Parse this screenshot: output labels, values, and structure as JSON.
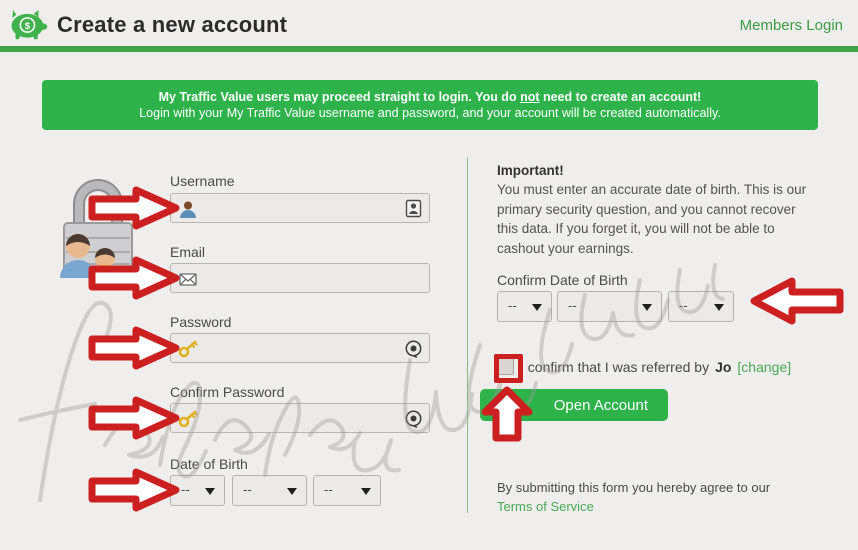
{
  "header": {
    "logo_icon": "piggy-bank-icon",
    "title": "Create a new account",
    "members_login": "Members Login",
    "accent_green": "#41a24a"
  },
  "banner": {
    "line1_a": "My Traffic Value users may proceed straight to login. You do ",
    "line1_underlined": "not",
    "line1_b": " need to create an account!",
    "line2": "Login with your My Traffic Value username and password, and your account will be created automatically.",
    "background": "#2eb34a"
  },
  "left_column": {
    "illustration_icon": "padlock-with-users-icon",
    "fields": [
      {
        "label": "Username",
        "value": "",
        "left_icon": "user-avatar-icon",
        "right_icon": "id-card-icon"
      },
      {
        "label": "Email",
        "value": "",
        "left_icon": "envelope-icon",
        "right_icon": ""
      },
      {
        "label": "Password",
        "value": "",
        "left_icon": "key-icon",
        "right_icon": "reveal-password-icon"
      },
      {
        "label": "Confirm Password",
        "value": "",
        "left_icon": "key-icon",
        "right_icon": "reveal-password-icon"
      }
    ],
    "dob": {
      "label": "Date of Birth",
      "day": "--",
      "month": "--",
      "year": "--"
    }
  },
  "right_column": {
    "important_title": "Important!",
    "important_body": "You must enter an accurate date of birth. This is our primary security question, and you cannot recover this data. If you forget it, you will not be able to cashout your earnings.",
    "confirm_dob": {
      "label": "Confirm Date of Birth",
      "day": "--",
      "month": "--",
      "year": "--"
    },
    "referral": {
      "checked": false,
      "text_before": "I confirm that I was referred by",
      "referrer": "Jo",
      "change_link": "[change]"
    },
    "open_account_label": "Open Account",
    "terms_prefix": "By submitting this form you hereby agree to our",
    "terms_link": "Terms of Service"
  },
  "annotations": {
    "arrow_color": "#cc1f1f",
    "arrows": [
      {
        "name": "arrow-to-username-field",
        "direction": "right"
      },
      {
        "name": "arrow-to-email-field",
        "direction": "right"
      },
      {
        "name": "arrow-to-password-field",
        "direction": "right"
      },
      {
        "name": "arrow-to-confirm-password-field",
        "direction": "right"
      },
      {
        "name": "arrow-to-date-of-birth-selects",
        "direction": "right"
      },
      {
        "name": "arrow-to-confirm-date-of-birth-selects",
        "direction": "left"
      },
      {
        "name": "arrow-to-open-account-button",
        "direction": "up"
      }
    ],
    "highlight_box": "referral-checkbox-highlight"
  },
  "watermark": {
    "text": "febrijoasetiyawan.com"
  }
}
